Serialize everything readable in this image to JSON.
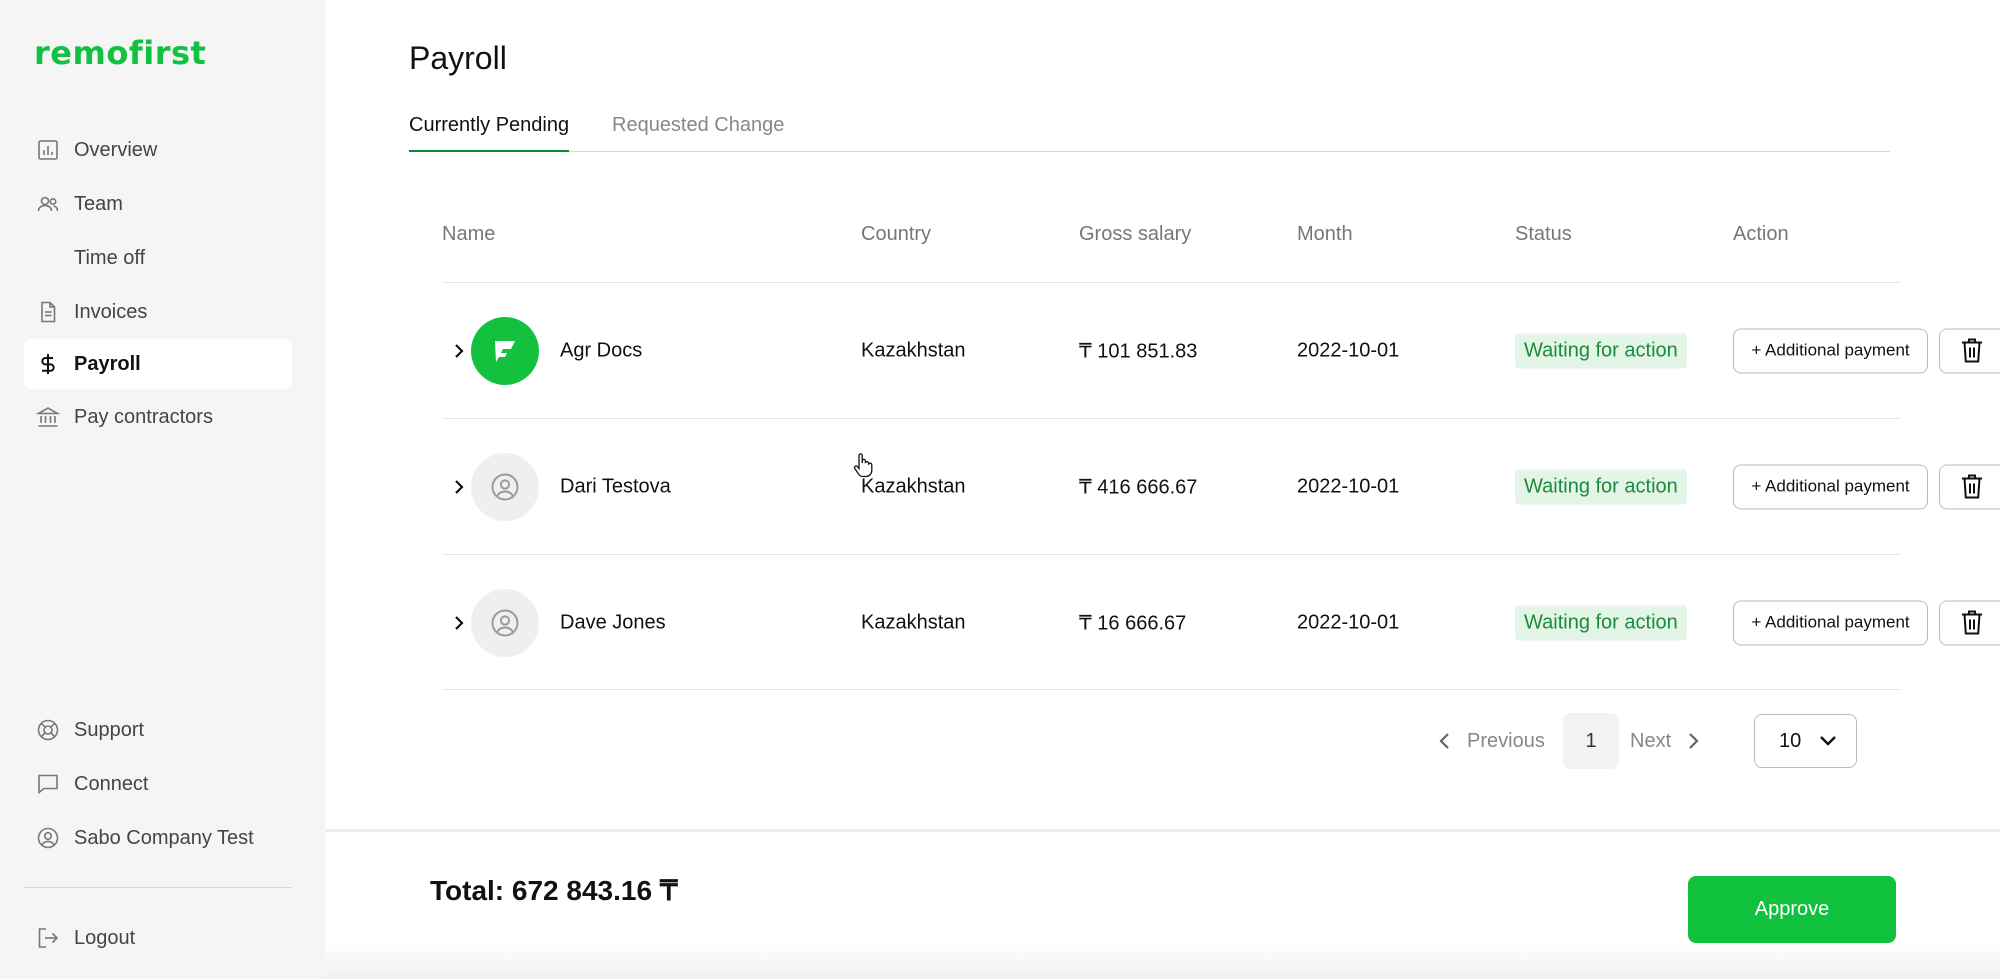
{
  "brand": {
    "logo": "remofirst",
    "accent": "#12c13f"
  },
  "sidebar": {
    "items": [
      {
        "label": "Overview",
        "icon": "chart-icon"
      },
      {
        "label": "Team",
        "icon": "users-icon"
      },
      {
        "label": "Time off",
        "icon": ""
      },
      {
        "label": "Invoices",
        "icon": "document-icon"
      },
      {
        "label": "Payroll",
        "icon": "dollar-icon",
        "active": true
      },
      {
        "label": "Pay contractors",
        "icon": "bank-icon"
      }
    ],
    "bottom_items": [
      {
        "label": "Support",
        "icon": "lifebuoy-icon"
      },
      {
        "label": "Connect",
        "icon": "chat-icon"
      },
      {
        "label": "Sabo Company Test",
        "icon": "user-circle-icon"
      },
      {
        "label": "Logout",
        "icon": "logout-icon"
      }
    ]
  },
  "main": {
    "title": "Payroll",
    "tabs": [
      {
        "label": "Currently Pending",
        "active": true
      },
      {
        "label": "Requested Change",
        "active": false
      }
    ],
    "table": {
      "headers": [
        "Name",
        "Country",
        "Gross salary",
        "Month",
        "Status",
        "Action"
      ],
      "rows": [
        {
          "name": "Agr Docs",
          "country": "Kazakhstan",
          "gross_salary": "₸ 101 851.83",
          "month": "2022-10-01",
          "status": "Waiting for action",
          "action": "+ Additional payment",
          "avatar": "brand"
        },
        {
          "name": "Dari Testova",
          "country": "Kazakhstan",
          "gross_salary": "₸ 416 666.67",
          "month": "2022-10-01",
          "status": "Waiting for action",
          "action": "+ Additional payment",
          "avatar": "default"
        },
        {
          "name": "Dave Jones",
          "country": "Kazakhstan",
          "gross_salary": "₸ 16 666.67",
          "month": "2022-10-01",
          "status": "Waiting for action",
          "action": "+ Additional payment",
          "avatar": "default"
        }
      ]
    },
    "pagination": {
      "previous": "Previous",
      "current_page": "1",
      "next": "Next",
      "page_size": "10"
    }
  },
  "footer": {
    "total": "Total: 672 843.16 ₸",
    "approve_label": "Approve",
    "approve_color": "#10c13e"
  }
}
